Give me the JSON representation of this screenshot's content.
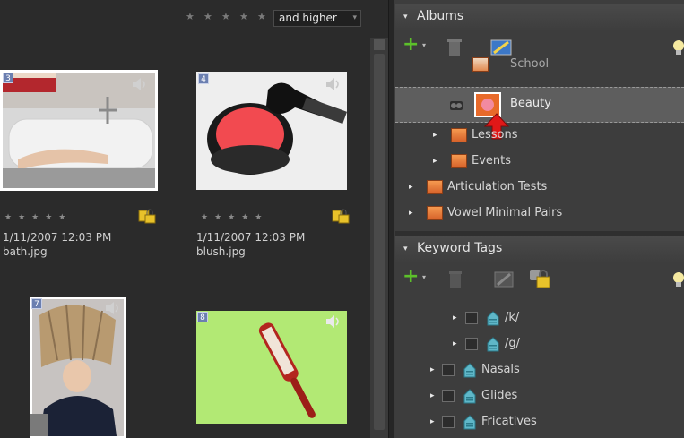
{
  "rating_filter": {
    "stars": [
      "★",
      "★",
      "★",
      "★",
      "★"
    ],
    "selected": "and higher",
    "dropdown_arrow": "▾"
  },
  "media": [
    {
      "number": "3",
      "stars": "★★★★★",
      "date": "1/11/2007 12:03 PM",
      "filename": "bath.jpg"
    },
    {
      "number": "4",
      "stars": "★★★★★",
      "date": "1/11/2007 12:03 PM",
      "filename": "blush.jpg"
    },
    {
      "number": "7"
    },
    {
      "number": "8"
    }
  ],
  "albums": {
    "title": "Albums",
    "collapse_glyph": "▾",
    "add_glyph": "+",
    "items": [
      {
        "label": "School"
      },
      {
        "label": "Beauty"
      },
      {
        "label": "Lessons",
        "expand": "▸"
      },
      {
        "label": "Events",
        "expand": "▸"
      },
      {
        "label": "Articulation Tests",
        "expand": "▸"
      },
      {
        "label": "Vowel Minimal Pairs",
        "expand": "▸"
      }
    ]
  },
  "keyword_tags": {
    "title": "Keyword Tags",
    "collapse_glyph": "▾",
    "add_glyph": "+",
    "items": [
      {
        "label": "/k/",
        "expand": "▸"
      },
      {
        "label": "/g/",
        "expand": "▸"
      },
      {
        "label": "Nasals",
        "expand": "▸"
      },
      {
        "label": "Glides",
        "expand": "▸"
      },
      {
        "label": "Fricatives",
        "expand": "▸"
      }
    ]
  },
  "colors": {
    "selected_row": "#5e5e5e",
    "folder": "#e97a3a",
    "pointer_arrow": "#e01818",
    "add_green": "#5cc02a"
  }
}
